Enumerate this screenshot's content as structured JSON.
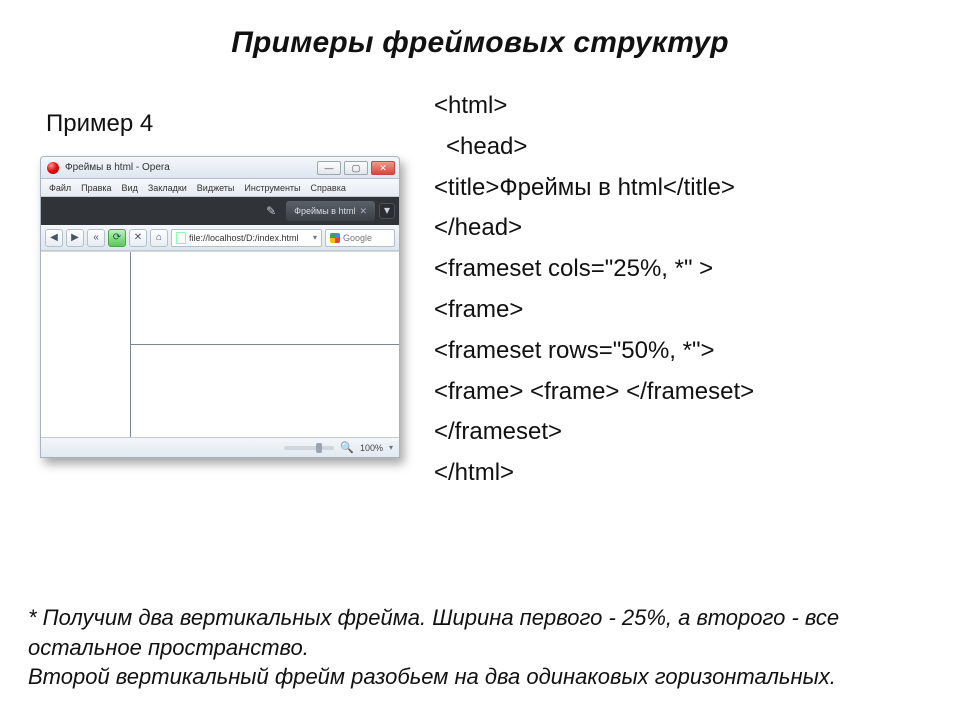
{
  "title": "Примеры фреймовых структур",
  "subheading": "Пример 4",
  "browser": {
    "window_title": "Фреймы в html - Opera",
    "window_buttons": {
      "min": "—",
      "max": "▢",
      "close": "✕"
    },
    "menu": [
      "Файл",
      "Правка",
      "Вид",
      "Закладки",
      "Виджеты",
      "Инструменты",
      "Справка"
    ],
    "tab_label": "Фреймы в html",
    "tab_close": "✕",
    "newtab_glyph": "▾",
    "wrench_glyph": "✎",
    "nav": {
      "back": "◀",
      "fwd": "▶",
      "rewind": "«",
      "reload": "⟳",
      "stop": "✕",
      "home": "⌂"
    },
    "url": "file://localhost/D:/index.html",
    "addr_drop": "▾",
    "search_placeholder": "Google",
    "zoom_label": "100%",
    "magnify_glyph": "🔍"
  },
  "code": {
    "l1": "<html>",
    "l2": "<head>",
    "l3": "<title>Фреймы в html</title>",
    "l4": "</head>",
    "l5": "<frameset cols=\"25%, *\" >",
    "l6": "<frame>",
    "l7": "<frameset rows=\"50%, *\">",
    "l8": "<frame> <frame> </frameset>",
    "l9": "</frameset>",
    "l10": "</html>"
  },
  "footnote": {
    "p1": "* Получим два вертикальных фрейма. Ширина первого - 25%, а второго - все остальное пространство.",
    "p2": "Второй вертикальный фрейм разобьем на два одинаковых горизонтальных."
  }
}
